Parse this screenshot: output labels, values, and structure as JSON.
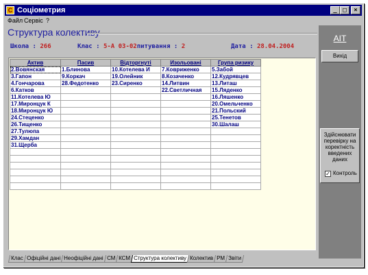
{
  "window": {
    "title": "Соціометрия",
    "app_icon": "app-icon",
    "controls": {
      "minimize": "_",
      "maximize": "□",
      "close": "×"
    }
  },
  "menu": [
    "Файл",
    "Сервіс",
    "?"
  ],
  "header": {
    "title": "Структура колективу",
    "school_label": "Школа :",
    "school_value": "266",
    "class_label": "Клас :",
    "class_value": "5-А 03-02",
    "question_label": "питування :",
    "question_value": "2",
    "date_label": "Дата :",
    "date_value": "28.04.2004"
  },
  "table": {
    "columns": [
      "Актив",
      "Пасив",
      "Відторгнуті",
      "Изольовані",
      "Група ризику"
    ],
    "rows": [
      [
        "2.Вовянская",
        "1.Блинова",
        "10.Котелева И",
        "7.Ковриженко",
        "5.Забой"
      ],
      [
        "3.Гапон",
        "9.Коркач",
        "19.Олейник",
        "8.Козаченко",
        "12.Кудрявцев"
      ],
      [
        "4.Гончарова",
        "28.Федотенко",
        "23.Сиренко",
        "14.Литвин",
        "13.Литаш"
      ],
      [
        "6.Катков",
        "",
        "",
        "22.Светличная",
        "15.Ляденко"
      ],
      [
        "11.Котелева Ю",
        "",
        "",
        "",
        "16.Ляшенко"
      ],
      [
        "17.Миронцук К",
        "",
        "",
        "",
        "20.Омельченко"
      ],
      [
        "18.Миронцук Ю",
        "",
        "",
        "",
        "21.Польский"
      ],
      [
        "24.Стеценко",
        "",
        "",
        "",
        "25.Тенетов"
      ],
      [
        "26.Тищенко",
        "",
        "",
        "",
        "30.Шалаш"
      ],
      [
        "27.Тулюпа",
        "",
        "",
        "",
        ""
      ],
      [
        "29.Хамдан",
        "",
        "",
        "",
        ""
      ],
      [
        "31.Щерба",
        "",
        "",
        "",
        ""
      ]
    ]
  },
  "tabs": [
    "Клас",
    "Офіційні дані",
    "Неофіційні дані",
    "СМ",
    "КСМ",
    "Структура колективу",
    "Колектив",
    "РМ",
    "Звіти"
  ],
  "active_tab": "Структура колективу",
  "sidebar": {
    "logo": "АІТ",
    "exit_label": "Вихід",
    "check_note": "Здійснювати перевірку на коректність введених даних",
    "control_label": "Контроль",
    "control_checked": true
  }
}
